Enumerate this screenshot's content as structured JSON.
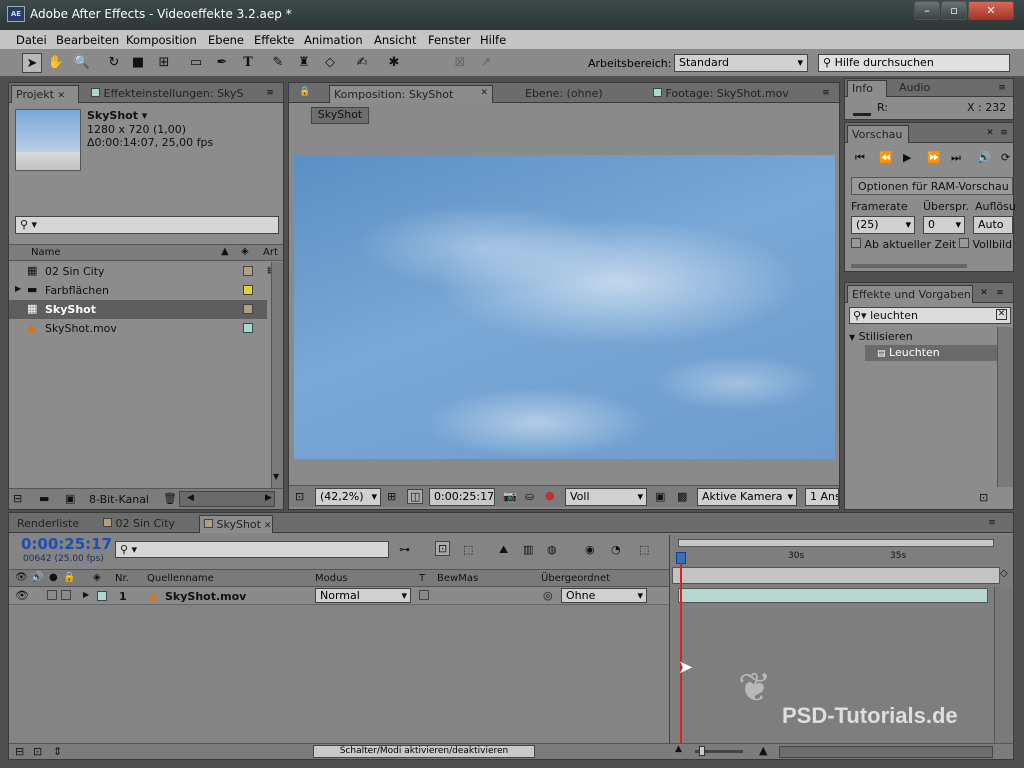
{
  "window": {
    "title": "Adobe After Effects - Videoeffekte 3.2.aep *",
    "icon_text": "AE",
    "controls": [
      "–",
      "▫",
      "✕"
    ]
  },
  "menu": [
    "Datei",
    "Bearbeiten",
    "Komposition",
    "Ebene",
    "Effekte",
    "Animation",
    "Ansicht",
    "Fenster",
    "Hilfe"
  ],
  "toolbar": {
    "workspace_label": "Arbeitsbereich:",
    "workspace_value": "Standard",
    "help_placeholder": "Hilfe durchsuchen"
  },
  "project": {
    "tabs": [
      "Projekt",
      "Effekteinstellungen: SkyS"
    ],
    "item_name": "SkyShot ▾",
    "item_dims": "1280 x 720 (1,00)",
    "item_duration": "Δ0:00:14:07, 25,00 fps",
    "col_name": "Name",
    "col_type": "Art",
    "items": [
      {
        "name": "02 Sin City",
        "color": "#b0a080"
      },
      {
        "name": "Farbflächen",
        "color": "#e0d040"
      },
      {
        "name": "SkyShot",
        "color": "#b0a080"
      },
      {
        "name": "SkyShot.mov",
        "color": "#a8d8d0"
      }
    ],
    "bitdepth": "8-Bit-Kanal"
  },
  "comp": {
    "tabs": [
      "Komposition: SkyShot",
      "Ebene: (ohne)",
      "Footage: SkyShot.mov"
    ],
    "crumb": "SkyShot",
    "zoom": "(42,2%)",
    "timecode": "0:00:25:17",
    "resolution": "Voll",
    "camera": "Aktive Kamera",
    "views": "1 Ans"
  },
  "info": {
    "tabs": [
      "Info",
      "Audio"
    ],
    "r_label": "R:",
    "x_label": "X : 232"
  },
  "preview": {
    "tab": "Vorschau",
    "ram_label": "Optionen für RAM-Vorschau",
    "framerate_label": "Framerate",
    "skip_label": "Überspr.",
    "res_label": "Auflösu",
    "framerate_value": "(25)",
    "skip_value": "0",
    "res_value": "Auto",
    "from_current": "Ab aktueller Zeit",
    "fullscreen": "Vollbild"
  },
  "effects": {
    "tab": "Effekte und Vorgaben",
    "search": "leuchten",
    "category": "Stilisieren",
    "effect": "Leuchten"
  },
  "timeline": {
    "tabs": [
      "Renderliste",
      "02 Sin City",
      "SkyShot"
    ],
    "timecode": "0:00:25:17",
    "frame_info": "00642 (25.00 fps)",
    "headers": {
      "nr": "Nr.",
      "source": "Quellenname",
      "mode": "Modus",
      "t": "T",
      "trkmat": "BewMas",
      "parent": "Übergeordnet"
    },
    "layer": {
      "nr": "1",
      "name": "SkyShot.mov",
      "mode": "Normal",
      "parent": "Ohne"
    },
    "ruler": [
      "30s",
      "35s"
    ],
    "toggle_label": "Schalter/Modi aktivieren/deaktivieren"
  },
  "watermark": "PSD-Tutorials.de"
}
